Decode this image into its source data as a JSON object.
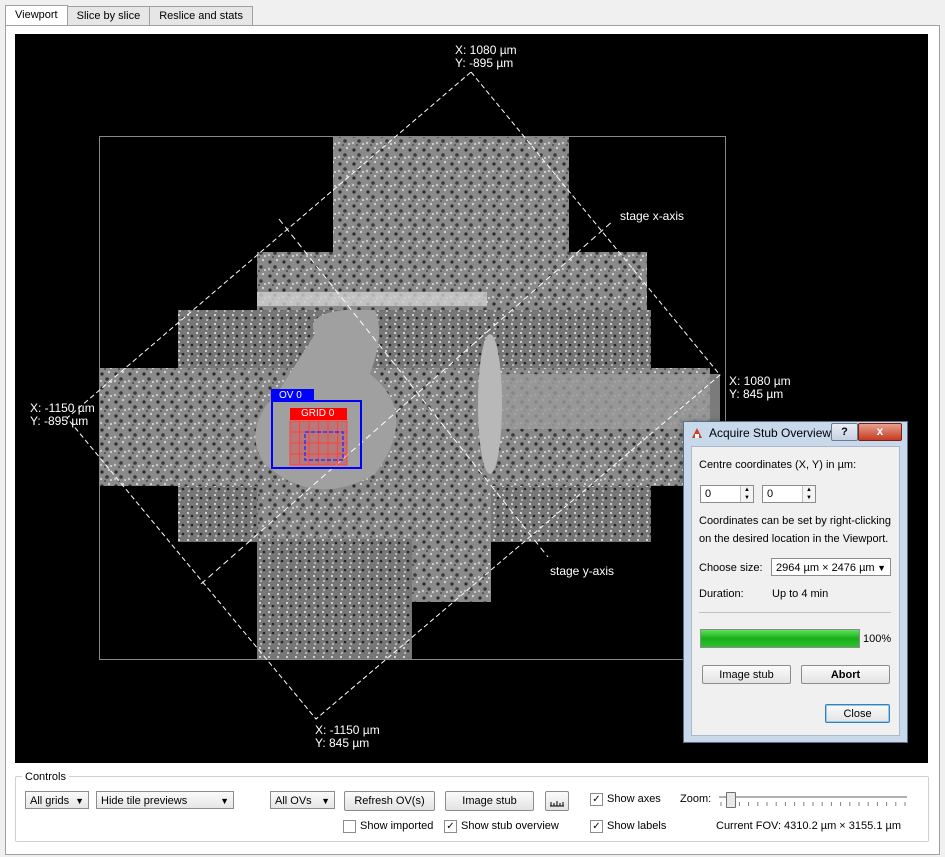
{
  "tabs": [
    {
      "label": "Viewport",
      "active": true
    },
    {
      "label": "Slice by slice",
      "active": false
    },
    {
      "label": "Reslice and stats",
      "active": false
    }
  ],
  "viewport": {
    "corner_top": "X: 1080 µm\nY: -895 µm",
    "corner_right": "X: 1080 µm\nY: 845 µm",
    "corner_left": "X: -1150 µm\nY: -895 µm",
    "corner_bottom": "X: -1150 µm\nY: 845 µm",
    "x_axis_label": "stage x-axis",
    "y_axis_label": "stage y-axis",
    "ov_label": "OV 0",
    "grid_label": "GRID 0",
    "colors": {
      "ov": "#0000ff",
      "grid": "#ff0000",
      "axes": "#ffffff",
      "background": "#000000"
    }
  },
  "controls": {
    "title": "Controls",
    "grids_combo": "All grids",
    "tile_previews_combo": "Hide tile previews",
    "ovs_combo": "All OVs",
    "refresh_button": "Refresh OV(s)",
    "image_stub_button": "Image stub",
    "measure_icon": "ruler-icon",
    "show_imported": {
      "label": "Show imported",
      "checked": false
    },
    "show_stub_overview": {
      "label": "Show stub overview",
      "checked": true
    },
    "show_axes": {
      "label": "Show axes",
      "checked": true
    },
    "show_labels": {
      "label": "Show labels",
      "checked": true
    },
    "zoom_label": "Zoom:",
    "zoom_level": 0.04,
    "current_fov": "Current FOV: 4310.2 µm × 3155.1 µm"
  },
  "dialog": {
    "title": "Acquire Stub Overview",
    "help_glyph": "?",
    "close_glyph": "x",
    "centre_label": "Centre coordinates (X, Y) in µm:",
    "x_value": "0",
    "y_value": "0",
    "hint_line1": "Coordinates can be set by right-clicking",
    "hint_line2": "on the desired location in the Viewport.",
    "size_label": "Choose size:",
    "size_value": "2964 µm × 2476 µm",
    "duration_label": "Duration:",
    "duration_value": "Up to 4 min",
    "progress": 100,
    "progress_text": "100%",
    "image_stub_button": "Image stub",
    "abort_button": "Abort",
    "close_button": "Close"
  }
}
